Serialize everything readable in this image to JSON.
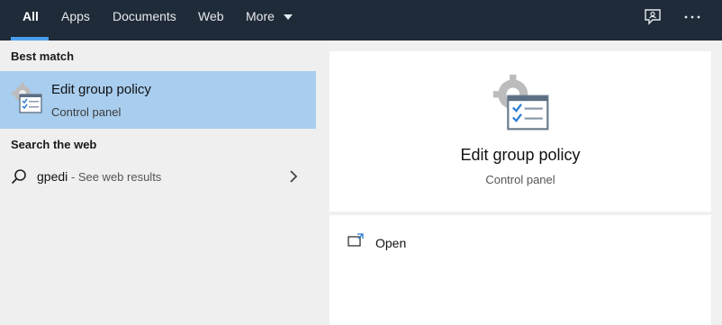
{
  "tabs": [
    {
      "label": "All",
      "active": true
    },
    {
      "label": "Apps"
    },
    {
      "label": "Documents"
    },
    {
      "label": "Web"
    },
    {
      "label": "More"
    }
  ],
  "header_icons": [
    "feedback-icon",
    "more-options-icon"
  ],
  "left": {
    "best_match_label": "Best match",
    "best_match": {
      "title": "Edit group policy",
      "subtitle": "Control panel"
    },
    "search_web_label": "Search the web",
    "web_result": {
      "query": "gpedi",
      "hint": " - See web results"
    }
  },
  "preview": {
    "title": "Edit group policy",
    "subtitle": "Control panel"
  },
  "actions": [
    {
      "label": "Open",
      "icon": "open-icon"
    }
  ],
  "colors": {
    "topbar": "#1f2b38",
    "accent": "#4a9eea",
    "selection": "#a8cdee",
    "pane_bg": "#efefef",
    "card_bg": "#ffffff"
  }
}
